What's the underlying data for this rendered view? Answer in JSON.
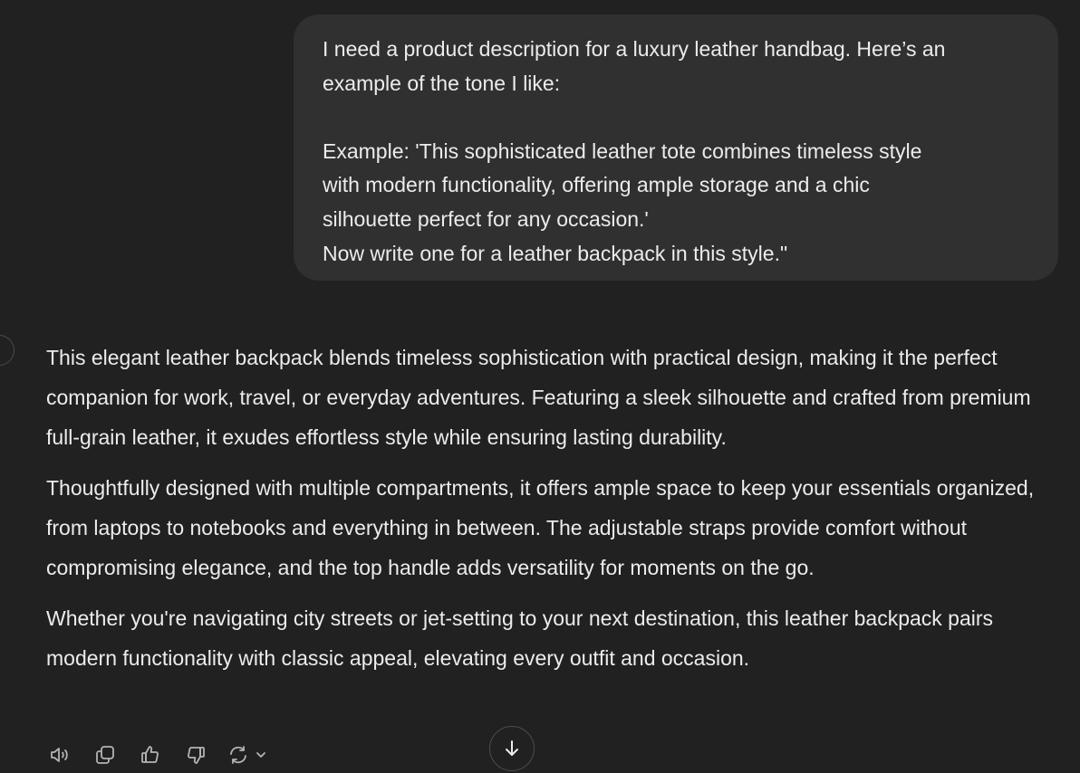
{
  "conversation": {
    "user_message": {
      "line1": "I need a product description for a luxury leather handbag. Here’s an",
      "line2": "example of the tone I like:",
      "line3": "Example: 'This sophisticated leather tote combines timeless style",
      "line4": "with modern functionality, offering ample storage and a chic",
      "line5": "silhouette perfect for any occasion.'",
      "line6": "Now write one for a leather backpack in this style.\""
    },
    "assistant_message": {
      "paragraphs": [
        "This elegant leather backpack blends timeless sophistication with practical design, making it the perfect companion for work, travel, or everyday adventures. Featuring a sleek silhouette and crafted from premium full-grain leather, it exudes effortless style while ensuring lasting durability.",
        "Thoughtfully designed with multiple compartments, it offers ample space to keep your essentials organized, from laptops to notebooks and everything in between. The adjustable straps provide comfort without compromising elegance, and the top handle adds versatility for moments on the go.",
        "Whether you're navigating city streets or jet-setting to your next destination, this leather backpack pairs modern functionality with classic appeal, elevating every outfit and occasion."
      ]
    }
  },
  "actions": {
    "icons": [
      "speaker-icon",
      "copy-icon",
      "thumbs-up-icon",
      "thumbs-down-icon",
      "regenerate-icon",
      "chevron-down-icon",
      "arrow-down-icon"
    ]
  },
  "colors": {
    "background": "#212121",
    "user_bubble": "#303030",
    "text": "#ececec",
    "icon": "#b4b4b4"
  }
}
